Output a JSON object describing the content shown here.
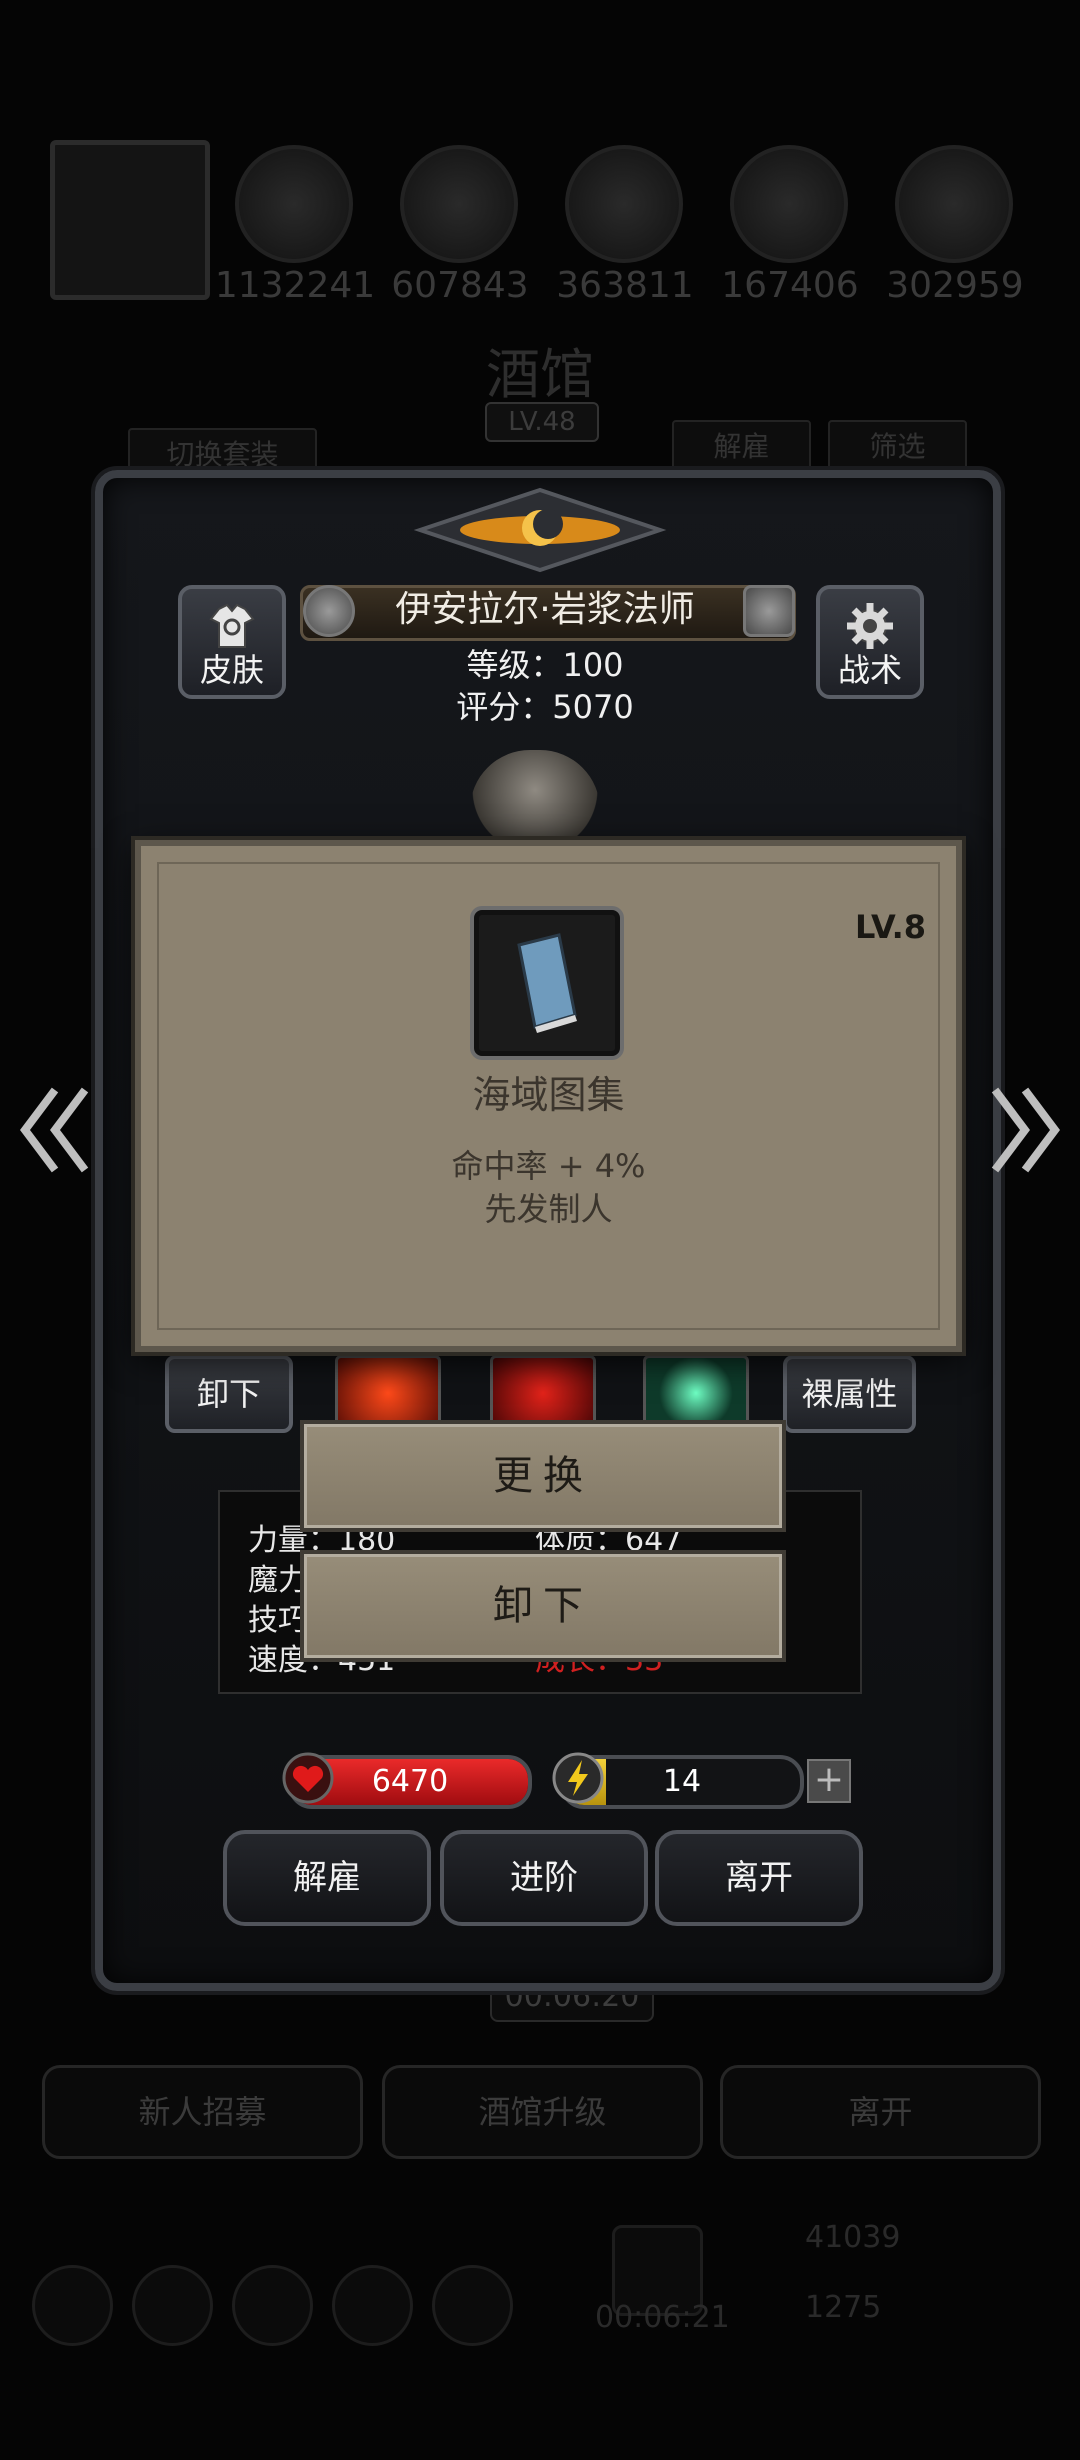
{
  "background": {
    "resources": [
      "1132241",
      "607843",
      "363811",
      "167406",
      "302959"
    ],
    "title": "酒馆",
    "level": "LV.48",
    "switch_outfit": "切换套装",
    "dismiss": "解雇",
    "filter": "筛选",
    "timer": "00:06:20",
    "bottom_buttons": [
      "新人招募",
      "酒馆升级",
      "离开"
    ],
    "footer_timer": "00:06:21",
    "footer_gold": "41039",
    "footer_gems": "1275"
  },
  "hero": {
    "name": "伊安拉尔·岩浆法师",
    "level_label": "等级：100",
    "score_label": "评分：5070",
    "skin_label": "皮肤",
    "tactics_label": "战术",
    "unequip_label": "卸下",
    "naked_attr_label": "裸属性",
    "attributes": {
      "col1": [
        "力量：180",
        "魔力",
        "技巧",
        "速度：451"
      ],
      "col2": [
        "体质：647",
        "成长：33"
      ]
    },
    "hp": "6470",
    "hp_fraction": 1.0,
    "energy": "14",
    "energy_fraction": 0.18,
    "actions": [
      "解雇",
      "进阶",
      "离开"
    ]
  },
  "item_popup": {
    "level": "LV.8",
    "name": "海域图集",
    "effects": [
      "命中率 + 4%",
      "先发制人"
    ]
  },
  "context_menu": {
    "replace": "更换",
    "unequip": "卸下"
  },
  "colors": {
    "hp_red": "#c0141a",
    "energy_yellow": "#e6c21c",
    "popup_parchment": "#8c8270"
  }
}
